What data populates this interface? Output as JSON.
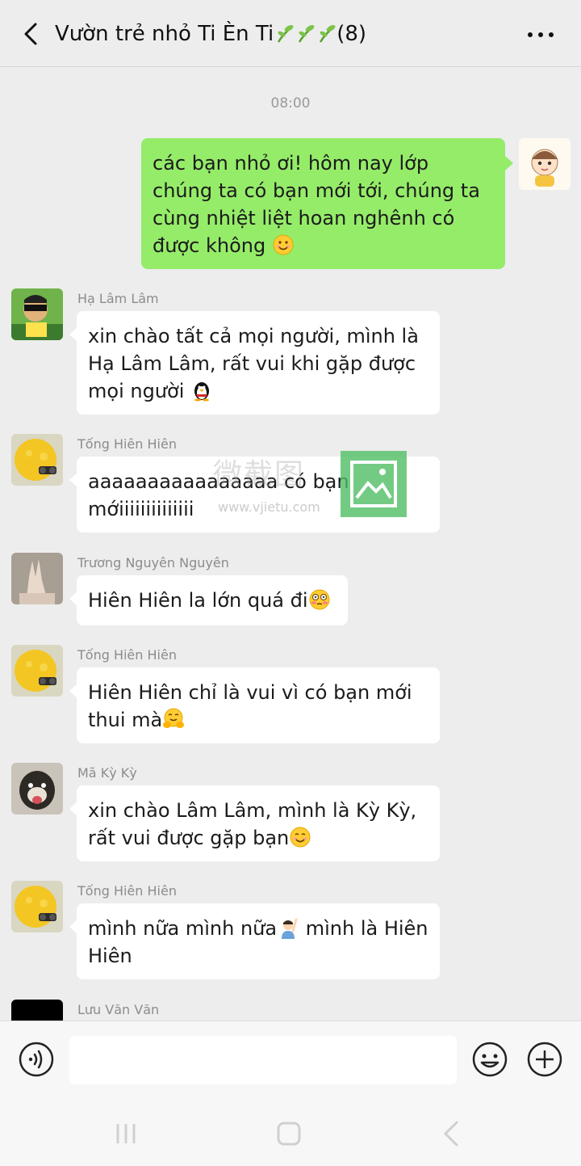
{
  "header": {
    "title_prefix": "Vườn trẻ nhỏ Ti Èn Ti",
    "member_count": "(8)"
  },
  "time_divider": "08:00",
  "watermark": {
    "text": "微截图",
    "url": "www.vjietu.com"
  },
  "messages": [
    {
      "sender": "",
      "text": "các bạn nhỏ ơi! hôm nay lớp chúng ta có bạn mới tới, chúng ta cùng nhiệt liệt hoan nghênh có được không",
      "emoji": "smiling-face-emoji"
    },
    {
      "sender": "Hạ Lâm Lâm",
      "line1": "xin chào tất cả mọi người, mình là",
      "line2": "Hạ Lâm Lâm, rất vui khi gặp được",
      "line3": "mọi người",
      "emoji": "penguin-emoji"
    },
    {
      "sender": "Tống Hiên Hiên",
      "line1": "aaaaaaaaaaaaaaaa có bạn",
      "line2": "mớiiiiiiiiiiiiii"
    },
    {
      "sender": "Trương Nguyên Nguyên",
      "text": "Hiên Hiên la lớn quá đi",
      "emoji": "flushed-face-emoji"
    },
    {
      "sender": "Tống Hiên Hiên",
      "line1": "Hiên Hiên chỉ là vui vì có bạn mới",
      "line2": "thui mà",
      "emoji": "hugging-face-emoji"
    },
    {
      "sender": "Mã Kỳ Kỳ",
      "line1": "xin chào Lâm Lâm, mình là Kỳ Kỳ,",
      "line2": "rất vui được gặp bạn",
      "emoji": "smiling-face-emoji"
    },
    {
      "sender": "Tống Hiên Hiên",
      "line1a": "mình nữa mình nữa",
      "line1b": " mình là Hiên",
      "line2": "Hiên",
      "emoji": "person-raising-hand-emoji"
    },
    {
      "sender": "Lưu Văn Văn"
    }
  ],
  "input": {
    "placeholder": ""
  },
  "colors": {
    "background": "#ededed",
    "my_bubble": "#95ec69",
    "other_bubble": "#ffffff"
  }
}
